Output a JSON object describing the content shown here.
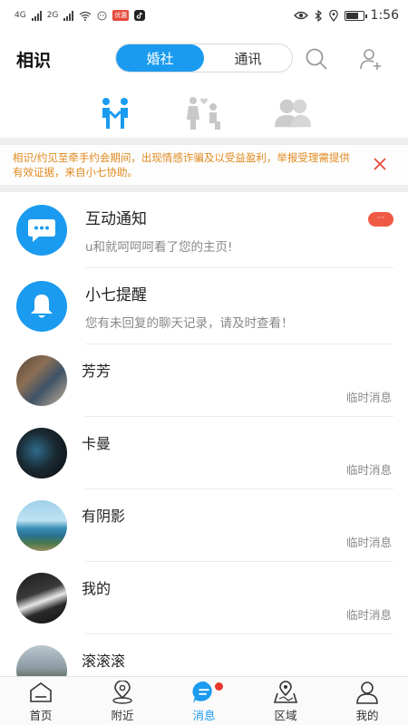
{
  "status_bar": {
    "network_left": "4G",
    "network_right": "2G",
    "carrier_badge": "优惠",
    "time": "1:56",
    "battery_level": 0.7
  },
  "header": {
    "title": "相识",
    "tabs": [
      {
        "label": "婚社",
        "active": true
      },
      {
        "label": "通讯",
        "active": false
      }
    ],
    "icons": [
      "search-icon",
      "add-user-icon"
    ]
  },
  "categories": [
    {
      "icon": "couple-m-icon",
      "active": true
    },
    {
      "icon": "proposal-icon",
      "active": false
    },
    {
      "icon": "friends-icon",
      "active": false
    }
  ],
  "notice": {
    "text": "相识/约见至牵手约会期间，出现情感诈骗及以受益盈利，举报受理需提供有效证据，来自小七协助。"
  },
  "system_items": [
    {
      "title": "互动通知",
      "subtitle": "u和就呵呵呵看了您的主页!",
      "icon": "chat-bubble-icon",
      "unread_badge": "···"
    },
    {
      "title": "小七提醒",
      "subtitle": "您有未回复的聊天记录，请及时查看！",
      "icon": "bell-icon"
    }
  ],
  "chats": [
    {
      "name": "芳芳",
      "tag": "临时消息"
    },
    {
      "name": "卡曼",
      "tag": "临时消息"
    },
    {
      "name": "有阴影",
      "tag": "临时消息"
    },
    {
      "name": "我的",
      "tag": "临时消息"
    },
    {
      "name": "滚滚滚",
      "tag": ""
    }
  ],
  "tabbar": [
    {
      "label": "首页",
      "icon": "home-icon",
      "active": false
    },
    {
      "label": "附近",
      "icon": "location-icon",
      "active": false
    },
    {
      "label": "消息",
      "icon": "message-icon",
      "active": true,
      "dot": true
    },
    {
      "label": "区域",
      "icon": "map-icon",
      "active": false
    },
    {
      "label": "我的",
      "icon": "profile-icon",
      "active": false
    }
  ],
  "colors": {
    "accent": "#1a9bf0",
    "notice_text": "#e08a1e",
    "badge_red": "#ef5a45"
  }
}
